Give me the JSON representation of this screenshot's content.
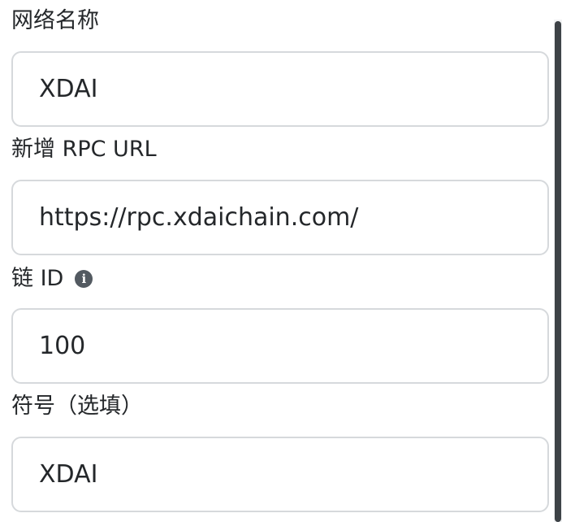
{
  "form": {
    "network_name": {
      "label": "网络名称",
      "value": "XDAI"
    },
    "rpc_url": {
      "label": "新增 RPC URL",
      "value": "https://rpc.xdaichain.com/"
    },
    "chain_id": {
      "label": "链 ID",
      "info_icon": "info-icon",
      "info_glyph": "i",
      "value": "100"
    },
    "symbol": {
      "label": "符号（选填）",
      "value": "XDAI"
    }
  }
}
